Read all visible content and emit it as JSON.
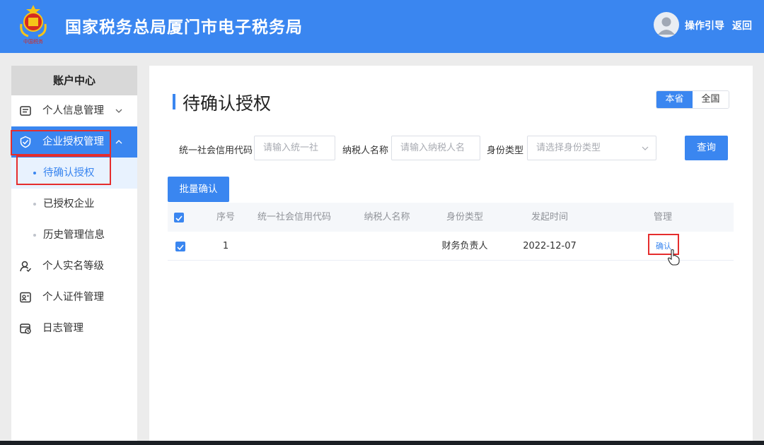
{
  "header": {
    "title": "国家税务总局厦门市电子税务局",
    "guide_label": "操作引导",
    "back_label": "返回",
    "bg_color": "#3a86f0"
  },
  "sidebar": {
    "title": "账户中心",
    "items": [
      {
        "label": "个人信息管理",
        "icon": "list-icon",
        "chevron": "down"
      },
      {
        "label": "企业授权管理",
        "icon": "shield-check-icon",
        "chevron": "up",
        "active": true
      },
      {
        "label": "个人实名等级",
        "icon": "user-icon"
      },
      {
        "label": "个人证件管理",
        "icon": "id-card-icon"
      },
      {
        "label": "日志管理",
        "icon": "calendar-clock-icon"
      }
    ],
    "subitems": [
      {
        "label": "待确认授权",
        "active": true
      },
      {
        "label": "已授权企业"
      },
      {
        "label": "历史管理信息"
      }
    ]
  },
  "main": {
    "page_title": "待确认授权",
    "scope_options": [
      "本省",
      "全国"
    ],
    "scope_selected": "本省",
    "filters": {
      "credit_code_label": "统一社会信用代码",
      "credit_code_placeholder": "请输入统一社",
      "taxpayer_name_label": "纳税人名称",
      "taxpayer_name_placeholder": "请输入纳税人名",
      "identity_type_label": "身份类型",
      "identity_type_placeholder": "请选择身份类型",
      "query_label": "查询"
    },
    "batch_confirm_label": "批量确认",
    "table": {
      "headers": [
        "序号",
        "统一社会信用代码",
        "纳税人名称",
        "身份类型",
        "发起时间",
        "管理"
      ],
      "rows": [
        {
          "index": "1",
          "credit_code": "",
          "taxpayer_name": "",
          "identity_type": "财务负责人",
          "initiated": "2022-12-07",
          "action": "确认",
          "checked": true
        }
      ]
    }
  },
  "colors": {
    "accent": "#3a86f0",
    "highlight": "#e52d2d"
  }
}
